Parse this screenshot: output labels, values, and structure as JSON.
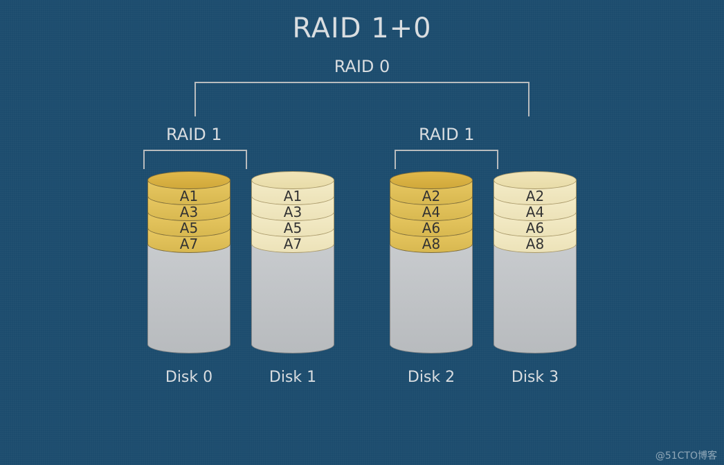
{
  "title": "RAID 1+0",
  "raid0_label": "RAID 0",
  "raid1_label": "RAID 1",
  "watermark": "@51CTO博客",
  "disks": [
    {
      "label": "Disk 0",
      "variant": "dark",
      "blocks": [
        "A1",
        "A3",
        "A5",
        "A7"
      ]
    },
    {
      "label": "Disk 1",
      "variant": "light",
      "blocks": [
        "A1",
        "A3",
        "A5",
        "A7"
      ]
    },
    {
      "label": "Disk 2",
      "variant": "dark",
      "blocks": [
        "A2",
        "A4",
        "A6",
        "A8"
      ]
    },
    {
      "label": "Disk 3",
      "variant": "light",
      "blocks": [
        "A2",
        "A4",
        "A6",
        "A8"
      ]
    }
  ],
  "chart_data": {
    "type": "diagram",
    "structure": "RAID 1+0 (RAID 10)",
    "top_level": "RAID 0 stripe across two RAID 1 mirror pairs",
    "mirror_pairs": [
      {
        "group": "RAID 1",
        "members": [
          "Disk 0",
          "Disk 1"
        ],
        "stripes": [
          "A1",
          "A3",
          "A5",
          "A7"
        ]
      },
      {
        "group": "RAID 1",
        "members": [
          "Disk 2",
          "Disk 3"
        ],
        "stripes": [
          "A2",
          "A4",
          "A6",
          "A8"
        ]
      }
    ]
  }
}
